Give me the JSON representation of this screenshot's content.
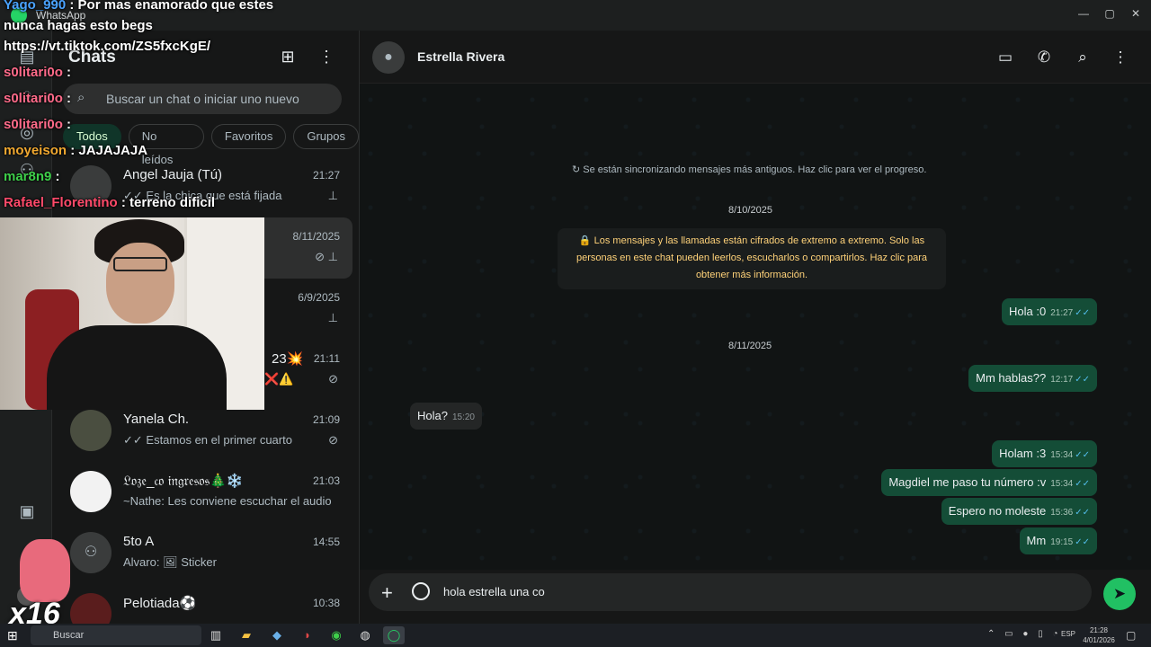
{
  "window": {
    "app_name": "WhatsApp",
    "controls": [
      "—",
      "▢",
      "✕"
    ]
  },
  "sidebar": {
    "title": "Chats",
    "search_placeholder": "Buscar un chat o iniciar uno nuevo",
    "filters": [
      "Todos",
      "No leídos",
      "Favoritos",
      "Grupos"
    ],
    "active_filter": "Todos",
    "chats": [
      {
        "name": "Angel Jauja (Tú)",
        "time": "21:27",
        "preview": "✓✓ Es la chica que está fijada",
        "mark": "pin-icon"
      },
      {
        "name": "",
        "time": "8/11/2025",
        "preview": "",
        "mark": "muted-pin-icon"
      },
      {
        "name": "",
        "time": "6/9/2025",
        "preview": "",
        "mark": "pin-icon"
      },
      {
        "name": "23💥",
        "time": "21:11",
        "preview": "❌⚠️",
        "mark": "muted-icon"
      },
      {
        "name": "Yanela Ch.",
        "time": "21:09",
        "preview": "✓✓ Estamos en el primer cuarto",
        "mark": "muted-icon"
      },
      {
        "name": "𝔏𝔬𝔷𝔢_𝔠𝔬 𝔦𝔫𝔤𝔯𝔢𝔰𝔬𝔰🎄❄️",
        "time": "21:03",
        "preview": "~Nathe: Les conviene escuchar el audio",
        "mark": ""
      },
      {
        "name": "5to A",
        "time": "14:55",
        "preview": "Alvaro: 🖼 Sticker",
        "mark": ""
      },
      {
        "name": "Pelotiada⚽",
        "time": "10:38",
        "preview": "",
        "mark": ""
      }
    ]
  },
  "conversation": {
    "contact_name": "Estrella Rivera",
    "sync_notice": "↻ Se están sincronizando mensajes más antiguos. Haz clic para ver el progreso.",
    "date_1": "8/10/2025",
    "encryption_notice": "🔒 Los mensajes y las llamadas están cifrados de extremo a extremo. Solo las personas en este chat pueden leerlos, escucharlos o compartirlos. Haz clic para obtener más información.",
    "date_2": "8/11/2025",
    "messages": [
      {
        "dir": "out",
        "text": "Hola :0",
        "time": "21:27"
      },
      {
        "dir": "out",
        "text": "Mm hablas??",
        "time": "12:17"
      },
      {
        "dir": "in",
        "text": "Hola?",
        "time": "15:20"
      },
      {
        "dir": "out",
        "text": "Holam :3",
        "time": "15:34"
      },
      {
        "dir": "out",
        "text": "Magdiel me paso tu número :v",
        "time": "15:34"
      },
      {
        "dir": "out",
        "text": "Espero no moleste",
        "time": "15:36"
      },
      {
        "dir": "out",
        "text": "Mm",
        "time": "19:15"
      }
    ],
    "composer_text": "hola estrella una co"
  },
  "overlay_chat": [
    {
      "user": "Yago_990",
      "msg": ": Por mas enamorado que estes",
      "color": "#4aa3ff"
    },
    {
      "user": "",
      "msg": "nunca hagas esto begs",
      "color": "#ffffff"
    },
    {
      "user": "",
      "msg": "https://vt.tiktok.com/ZS5fxcKgE/",
      "color": "#ffffff"
    },
    {
      "user": "s0litari0o",
      "msg": ":",
      "color": "#ff6b8a"
    },
    {
      "user": "s0litari0o",
      "msg": ":",
      "color": "#ff6b8a"
    },
    {
      "user": "s0litari0o",
      "msg": ":",
      "color": "#ff6b8a"
    },
    {
      "user": "moyeison",
      "msg": ": JAJAJAJA",
      "color": "#f0a830"
    },
    {
      "user": "mar8n9",
      "msg": ":",
      "color": "#3ecf4a"
    },
    {
      "user": "Rafael_Florentino",
      "msg": ": terreno dificil",
      "color": "#ff4a6a"
    }
  ],
  "overlay_badge": "x16",
  "taskbar": {
    "search_label": "Buscar",
    "language": "ESP",
    "time": "21:28",
    "date": "4/01/2026"
  }
}
